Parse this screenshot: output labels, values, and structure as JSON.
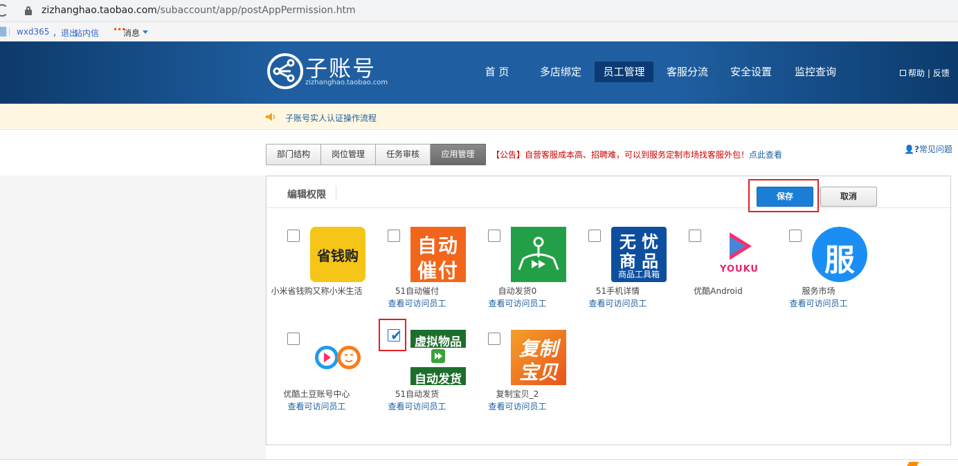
{
  "browser": {
    "url_host": "zizhanghao.taobao.com",
    "url_path": "/subaccount/app/postAppPermission.htm"
  },
  "topbar": {
    "user": "wxd365",
    "logout": "，退出",
    "inmail": "站内信",
    "messages": "消息"
  },
  "header": {
    "logo_title": "子账号",
    "logo_subtitle": "zizhanghao.taobao.com",
    "nav": [
      "首 页",
      "多店绑定",
      "员工管理",
      "客服分流",
      "安全设置",
      "监控查询"
    ],
    "active_nav": "员工管理",
    "help": "帮助",
    "feedback": "反馈",
    "help_sep": "|"
  },
  "notice": {
    "text": "子账号实人认证操作流程"
  },
  "tabs": [
    "部门结构",
    "岗位管理",
    "任务审核",
    "应用管理"
  ],
  "active_tab": "应用管理",
  "announcement": {
    "text": "【公告】自营客服成本高、招聘难，可以到服务定制市场找客服外包！",
    "link": "点此查看"
  },
  "faq": "常见问题",
  "panel": {
    "title": "编辑权限",
    "save": "保存",
    "cancel": "取消"
  },
  "view_staff_label": "查看可访问员工",
  "apps": [
    {
      "name": "小米省钱购又称小米生活",
      "checked": false,
      "show_link": false,
      "icon": "shengqiangou-icon",
      "icon_text": "省钱购",
      "color": "#f5c518"
    },
    {
      "name": "51自动催付",
      "checked": false,
      "show_link": true,
      "icon": "auto-remind-pay-icon",
      "icon_text": [
        "自动",
        "催付"
      ],
      "color": "#f2661c"
    },
    {
      "name": "自动发货0",
      "checked": false,
      "show_link": true,
      "icon": "auto-ship-icon",
      "color": "#23a047"
    },
    {
      "name": "51手机详情",
      "checked": false,
      "show_link": true,
      "icon": "wuyou-goods-icon",
      "icon_text": [
        "无 忧",
        "商 品",
        "商品工具箱"
      ],
      "color": "#0d4f9e"
    },
    {
      "name": "优酷Android",
      "checked": false,
      "show_link": false,
      "icon": "youku-icon",
      "icon_text": "YOUKU",
      "color": "#1e9bf0"
    },
    {
      "name": "服务市场",
      "checked": false,
      "show_link": true,
      "icon": "service-market-icon",
      "icon_text": "服",
      "color": "#1a8ef5"
    },
    {
      "name": "优酷土豆账号中心",
      "checked": false,
      "show_link": true,
      "icon": "youku-tudou-icon",
      "color": "#1e9bf0"
    },
    {
      "name": "51自动发货",
      "checked": true,
      "show_link": true,
      "icon": "virtual-goods-icon",
      "icon_text": [
        "虚拟物品",
        "自动发货"
      ],
      "color": "#1d6e2c"
    },
    {
      "name": "复制宝贝_2",
      "checked": false,
      "show_link": true,
      "icon": "copy-item-icon",
      "icon_text": [
        "复制",
        "宝贝"
      ],
      "color": "#e8531b"
    }
  ]
}
